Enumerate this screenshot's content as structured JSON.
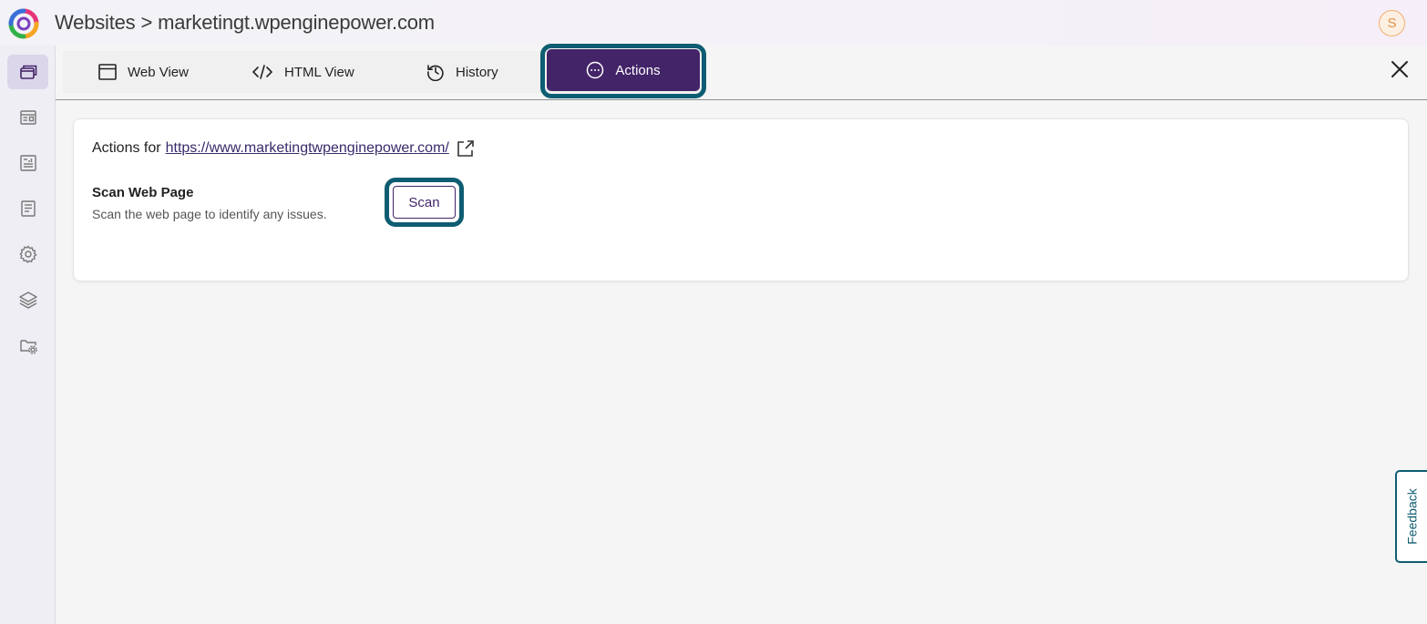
{
  "header": {
    "breadcrumb_root": "Websites",
    "breadcrumb_separator": ">",
    "breadcrumb_current": "marketingt.wpenginepower.com",
    "avatar_initial": "S"
  },
  "sidebar": {
    "items": [
      {
        "icon": "windows-icon",
        "active": true
      },
      {
        "icon": "dashboard-icon",
        "active": false
      },
      {
        "icon": "report-icon",
        "active": false
      },
      {
        "icon": "document-icon",
        "active": false
      },
      {
        "icon": "gear-icon",
        "active": false
      },
      {
        "icon": "layers-icon",
        "active": false
      },
      {
        "icon": "folder-settings-icon",
        "active": false
      }
    ]
  },
  "tabs": [
    {
      "label": "Web View",
      "icon": "browser-window-icon",
      "active": false
    },
    {
      "label": "HTML View",
      "icon": "code-icon",
      "active": false
    },
    {
      "label": "History",
      "icon": "history-icon",
      "active": false
    },
    {
      "label": "Actions",
      "icon": "more-circle-icon",
      "active": true
    }
  ],
  "actions_card": {
    "prefix": "Actions for",
    "url": "https://www.marketingtwpenginepower.com/",
    "scan_title": "Scan Web Page",
    "scan_description": "Scan the web page to identify any issues.",
    "scan_button": "Scan"
  },
  "feedback": {
    "label": "Feedback"
  },
  "colors": {
    "primary_purple": "#432468",
    "focus_ring_teal": "#0e5d72",
    "avatar_orange": "#e0934a"
  }
}
